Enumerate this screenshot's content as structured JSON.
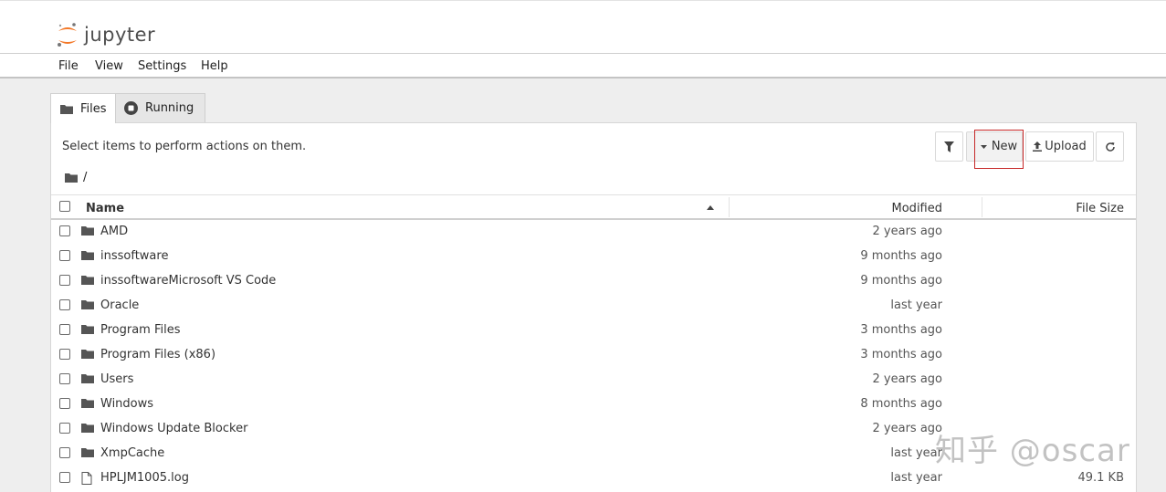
{
  "app": {
    "logo_text": "jupyter"
  },
  "menu": [
    "File",
    "View",
    "Settings",
    "Help"
  ],
  "tabs": [
    {
      "label": "Files",
      "icon": "folder-icon",
      "active": true
    },
    {
      "label": "Running",
      "icon": "stop-circle-icon",
      "active": false
    }
  ],
  "toolbar": {
    "hint": "Select items to perform actions on them.",
    "filter_icon": "filter-icon",
    "new_label": "New",
    "upload_label": "Upload",
    "refresh_icon": "refresh-icon"
  },
  "breadcrumb": {
    "path": "/"
  },
  "table": {
    "columns": {
      "name": "Name",
      "modified": "Modified",
      "size": "File Size"
    },
    "rows": [
      {
        "type": "folder",
        "name": "AMD",
        "modified": "2 years ago",
        "size": ""
      },
      {
        "type": "folder",
        "name": "inssoftware",
        "modified": "9 months ago",
        "size": ""
      },
      {
        "type": "folder",
        "name": "inssoftwareMicrosoft VS Code",
        "modified": "9 months ago",
        "size": ""
      },
      {
        "type": "folder",
        "name": "Oracle",
        "modified": "last year",
        "size": ""
      },
      {
        "type": "folder",
        "name": "Program Files",
        "modified": "3 months ago",
        "size": ""
      },
      {
        "type": "folder",
        "name": "Program Files (x86)",
        "modified": "3 months ago",
        "size": ""
      },
      {
        "type": "folder",
        "name": "Users",
        "modified": "2 years ago",
        "size": ""
      },
      {
        "type": "folder",
        "name": "Windows",
        "modified": "8 months ago",
        "size": ""
      },
      {
        "type": "folder",
        "name": "Windows Update Blocker",
        "modified": "2 years ago",
        "size": ""
      },
      {
        "type": "folder",
        "name": "XmpCache",
        "modified": "last year",
        "size": ""
      },
      {
        "type": "file",
        "name": "HPLJM1005.log",
        "modified": "last year",
        "size": "49.1 KB"
      }
    ]
  },
  "watermark": "知乎 @oscar",
  "colors": {
    "highlight_border": "#c62828",
    "logo_orange": "#f37726"
  }
}
